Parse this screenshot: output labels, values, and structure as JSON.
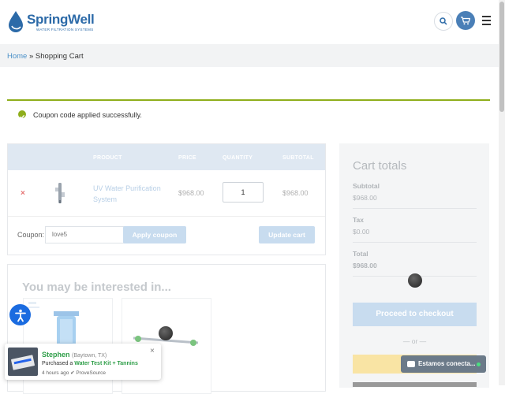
{
  "brand": {
    "name": "SpringWell",
    "tagline": "WATER FILTRATION SYSTEMS",
    "primary_color": "#2c6aa8",
    "accent_color": "#8fae1b"
  },
  "header": {
    "search_icon": "search-icon",
    "cart_icon": "cart-icon",
    "menu_icon": "hamburger-icon"
  },
  "breadcrumb": {
    "home": "Home",
    "separator": "»",
    "current": "Shopping Cart"
  },
  "notice": {
    "message": "Coupon code applied successfully."
  },
  "cart_table": {
    "headers": {
      "product": "PRODUCT",
      "price": "PRICE",
      "quantity": "QUANTITY",
      "subtotal": "SUBTOTAL"
    },
    "items": [
      {
        "remove": "×",
        "name": "UV Water Purification System",
        "price": "$968.00",
        "quantity": "1",
        "subtotal": "$968.00"
      }
    ],
    "coupon_label": "Coupon:",
    "coupon_value": "love5",
    "apply_button": "Apply coupon",
    "update_button": "Update cart"
  },
  "interested": {
    "title": "You may be interested in..."
  },
  "totals": {
    "title": "Cart totals",
    "subtotal_label": "Subtotal",
    "subtotal_value": "$968.00",
    "tax_label": "Tax",
    "tax_value": "$0.00",
    "total_label": "Total",
    "total_value": "$968.00",
    "checkout_button": "Proceed to checkout",
    "or_text": "— or —"
  },
  "popup": {
    "name": "Stephen",
    "location": "(Baytown, TX)",
    "purchased_prefix": "Purchased a",
    "product": "Water Test Kit + Tannins",
    "time": "4 hours ago",
    "source": "ProveSource",
    "close": "×"
  },
  "chat": {
    "label": "Estamos conecta..."
  }
}
